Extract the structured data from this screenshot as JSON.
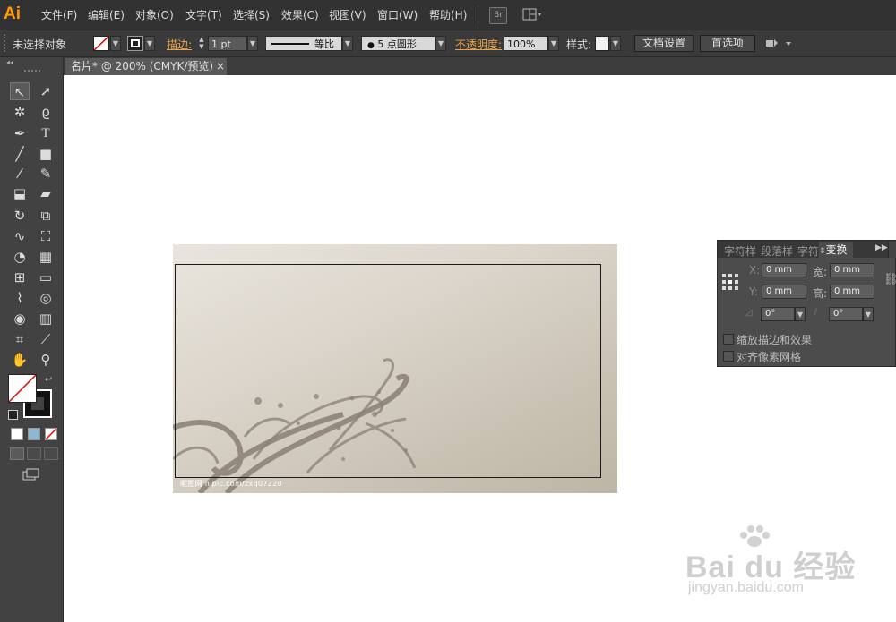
{
  "app": {
    "logo": "Ai"
  },
  "menu": [
    "文件(F)",
    "编辑(E)",
    "对象(O)",
    "文字(T)",
    "选择(S)",
    "效果(C)",
    "视图(V)",
    "窗口(W)",
    "帮助(H)"
  ],
  "menubar_buttons": {
    "bridge": "Br"
  },
  "control": {
    "selection_status": "未选择对象",
    "stroke_label": "描边:",
    "stroke_weight": "1 pt",
    "stroke_profile": "等比",
    "brush": "5 点圆形",
    "opacity_label": "不透明度:",
    "opacity_value": "100%",
    "style_label": "样式:",
    "doc_setup": "文档设置",
    "preferences": "首选项"
  },
  "document": {
    "tab_title": "名片* @ 200% (CMYK/预览)",
    "close": "×"
  },
  "artwork": {
    "footer_text": "昵图网 nipic.com/zxq07220"
  },
  "panel": {
    "tabs": [
      "字符样",
      "段落样",
      "字符",
      "变换"
    ],
    "active_tab": "变换",
    "x_label": "X:",
    "x_value": "0 mm",
    "w_label": "宽:",
    "w_value": "0 mm",
    "y_label": "Y:",
    "y_value": "0 mm",
    "h_label": "高:",
    "h_value": "0 mm",
    "rotate_value": "0°",
    "shear_value": "0°",
    "scale_strokes": "缩放描边和效果",
    "align_pixel": "对齐像素网格"
  },
  "watermark": {
    "brand": "Bai du 经验",
    "url": "jingyan.baidu.com"
  },
  "colors": {
    "accent": "#ff9a00",
    "canvas": "#ffffff",
    "ui_dark": "#323232",
    "panel": "#4c4c4c",
    "orange_label": "#e8a24a"
  }
}
